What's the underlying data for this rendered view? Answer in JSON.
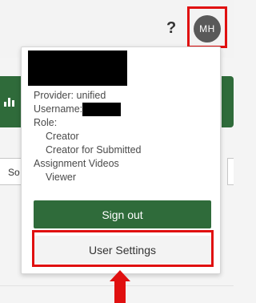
{
  "header": {
    "help_icon": "?",
    "avatar_initials": "MH"
  },
  "background": {
    "input_partial": "So"
  },
  "menu": {
    "provider": "Provider: unified",
    "username_label": "Username:",
    "role_label": "Role:",
    "roles": [
      "Creator",
      "Creator for Submitted",
      "Assignment Videos"
    ],
    "assignment_videos_child": "Viewer",
    "signout_label": "Sign out",
    "settings_label": "User Settings"
  },
  "colors": {
    "accent_green": "#2f6b3a",
    "highlight_red": "#e01010",
    "avatar_gray": "#595959"
  }
}
